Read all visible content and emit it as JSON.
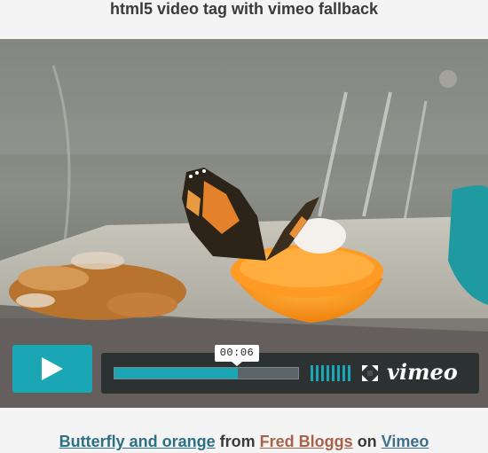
{
  "page": {
    "title": "html5 video tag with vimeo fallback"
  },
  "player": {
    "current_time": "00:06",
    "progress_fraction": 0.67,
    "brand": "vimeo",
    "play_icon": "play-icon",
    "volume_icon": "volume-bars-icon",
    "fullscreen_icon": "fullscreen-icon"
  },
  "caption": {
    "video_title": "Butterfly and orange",
    "from_text": "from",
    "author": "Fred Bloggs",
    "on_text": "on",
    "site": "Vimeo"
  },
  "colors": {
    "accent": "#1ba6b5",
    "control_bar": "#262c2d",
    "background": "#f4f4f4"
  }
}
